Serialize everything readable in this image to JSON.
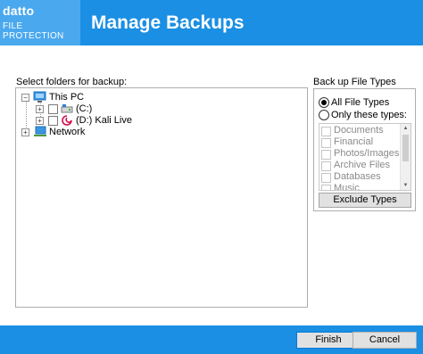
{
  "header": {
    "brand": "datto",
    "subtitle": "FILE PROTECTION",
    "title": "Manage Backups",
    "color": "#1b8fe3",
    "logo_bg": "#4aa8ee"
  },
  "folders": {
    "label": "Select folders for backup:",
    "tree": [
      {
        "label": "This PC",
        "icon": "computer-icon",
        "expanded": true,
        "checked": false
      },
      {
        "label": "(C:)",
        "icon": "drive-icon",
        "expanded": false,
        "checked": false
      },
      {
        "label": "(D:) Kali Live",
        "icon": "debian-swirl-icon",
        "expanded": false,
        "checked": false
      },
      {
        "label": "Network",
        "icon": "network-icon",
        "expanded": false
      }
    ]
  },
  "types": {
    "label": "Back up File Types",
    "all_label": "All File Types",
    "only_label": "Only these types:",
    "selected": "all",
    "items": [
      "Documents",
      "Financial",
      "Photos/Images",
      "Archive Files",
      "Databases",
      "Music"
    ],
    "exclude_label": "Exclude Types"
  },
  "footer": {
    "finish_label": "Finish",
    "cancel_label": "Cancel"
  }
}
